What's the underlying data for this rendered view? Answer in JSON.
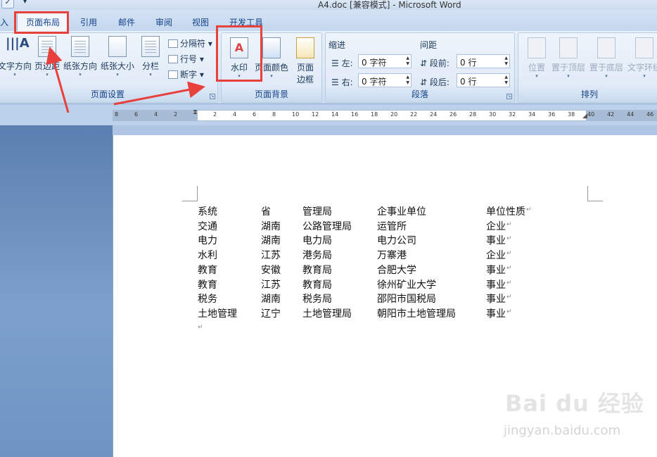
{
  "window": {
    "title": "A4.doc [兼容模式] - Microsoft Word"
  },
  "tabs": [
    {
      "label": "入",
      "active": false
    },
    {
      "label": "页面布局",
      "active": true
    },
    {
      "label": "引用",
      "active": false
    },
    {
      "label": "邮件",
      "active": false
    },
    {
      "label": "审阅",
      "active": false
    },
    {
      "label": "视图",
      "active": false
    },
    {
      "label": "开发工具",
      "active": false
    }
  ],
  "ribbon": {
    "page_setup": {
      "label": "页面设置",
      "text_direction": "文字方向",
      "margins": "页边距",
      "orientation": "纸张方向",
      "size": "纸张大小",
      "columns": "分栏",
      "breaks": "分隔符",
      "line_numbers": "行号",
      "hyphenation": "断字"
    },
    "page_background": {
      "label": "页面背景",
      "watermark": "水印",
      "page_color": "页面颜色",
      "page_borders_line1": "页面",
      "page_borders_line2": "边框"
    },
    "paragraph": {
      "label": "段落",
      "indent_label": "缩进",
      "spacing_label": "间距",
      "left_label": "左:",
      "right_label": "右:",
      "before_label": "段前:",
      "after_label": "段后:",
      "left_value": "0 字符",
      "right_value": "0 字符",
      "before_value": "0 行",
      "after_value": "0 行"
    },
    "arrange": {
      "label": "排列",
      "position": "位置",
      "bring_front": "置于顶层",
      "send_back": "置于底层",
      "text_wrap": "文字环绕"
    }
  },
  "ruler": {
    "ticks": [
      "8",
      "6",
      "4",
      "2",
      "2",
      "4",
      "6",
      "8",
      "10",
      "12",
      "14",
      "16",
      "18",
      "20",
      "22",
      "24",
      "26",
      "28",
      "30",
      "32",
      "34",
      "36",
      "38",
      "40",
      "42",
      "44",
      "46"
    ]
  },
  "document": {
    "rows": [
      [
        "系统",
        "省",
        "管理局",
        "企事业单位",
        "单位性质"
      ],
      [
        "交通",
        "湖南",
        "公路管理局",
        "运管所",
        "企业"
      ],
      [
        "电力",
        "湖南",
        "电力局",
        "电力公司",
        "事业"
      ],
      [
        "水利",
        "江苏",
        "港务局",
        "万寨港",
        "企业"
      ],
      [
        "教育",
        "安徽",
        "教育局",
        "合肥大学",
        "事业"
      ],
      [
        "教育",
        "江苏",
        "教育局",
        "徐州矿业大学",
        "事业"
      ],
      [
        "税务",
        "湖南",
        "税务局",
        "邵阳市国税局",
        "事业"
      ],
      [
        "土地管理",
        "辽宁",
        "土地管理局",
        "朝阳市土地管理局",
        "事业"
      ]
    ],
    "paragraph_mark": "↵"
  },
  "watermark_logo": "Bai du 经验",
  "watermark_url": "jingyan.baidu.com",
  "colors": {
    "annotation_red": "#e8403c",
    "ribbon_text": "#15428b"
  }
}
